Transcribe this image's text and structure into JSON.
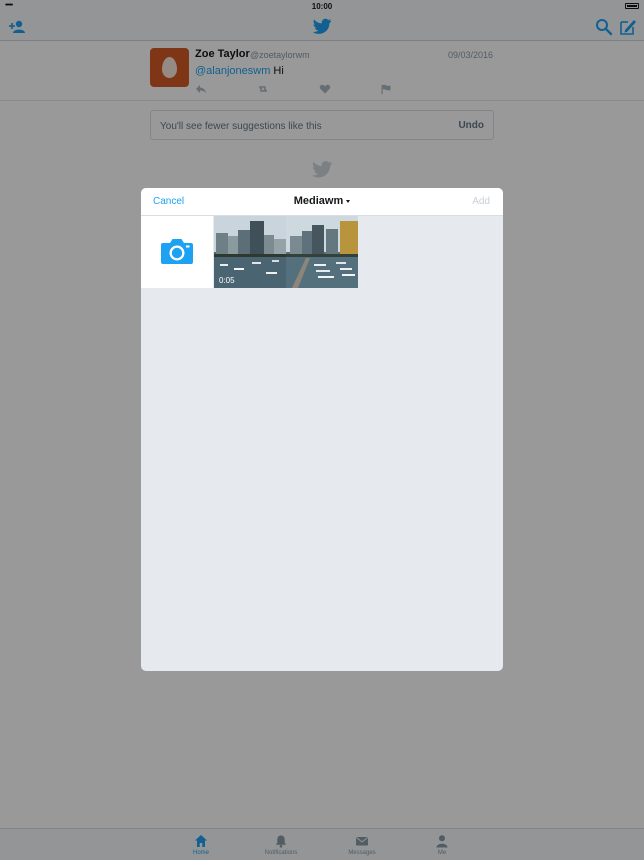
{
  "status_bar": {
    "signal": "•••••",
    "time": "10:00"
  },
  "tweet": {
    "name": "Zoe Taylor",
    "handle": "@zoetaylorwm",
    "date": "09/03/2016",
    "mention": "@alanjoneswm",
    "text": " Hi"
  },
  "suggestion": {
    "text": "You'll see fewer suggestions like this",
    "undo_label": "Undo"
  },
  "modal": {
    "cancel_label": "Cancel",
    "album_title": "Mediawm",
    "add_label": "Add",
    "media": [
      {
        "type": "video",
        "duration": "0:05"
      },
      {
        "type": "photo"
      }
    ]
  },
  "tabs": [
    {
      "label": "Home",
      "icon": "home-icon",
      "active": true
    },
    {
      "label": "Notifications",
      "icon": "bell-icon",
      "active": false
    },
    {
      "label": "Messages",
      "icon": "envelope-icon",
      "active": false
    },
    {
      "label": "Me",
      "icon": "person-icon",
      "active": false
    }
  ],
  "colors": {
    "accent": "#1da1f2",
    "avatar": "#d45a26",
    "muted_text": "#8899a6"
  }
}
